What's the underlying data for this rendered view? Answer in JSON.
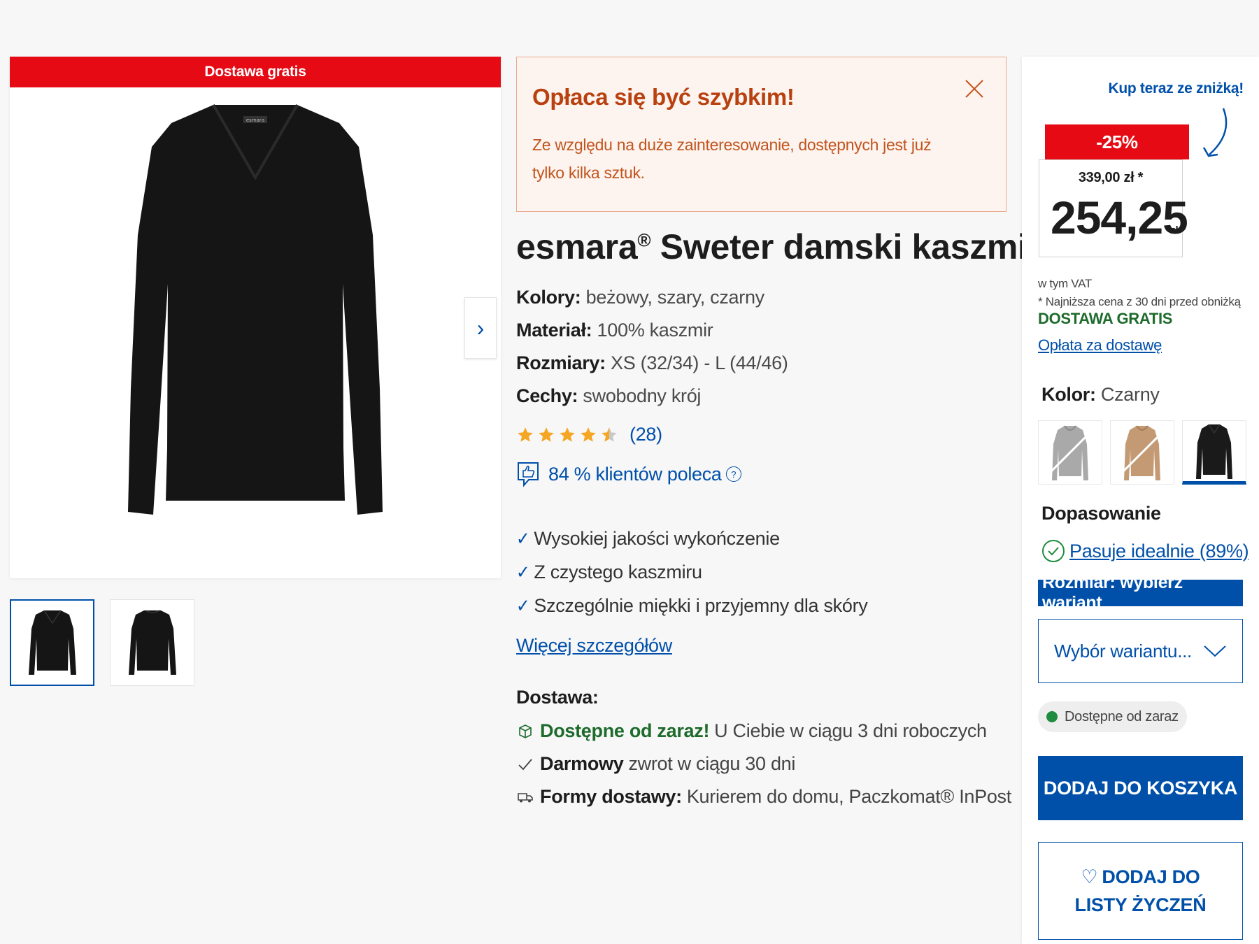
{
  "gallery": {
    "banner": "Dostawa gratis",
    "next_glyph": "›",
    "thumbnails": [
      "front",
      "back"
    ]
  },
  "alert": {
    "title": "Opłaca się być szybkim!",
    "text": "Ze względu na duże zainteresowanie, dostępnych jest już tylko kilka sztuk."
  },
  "product": {
    "brand": "esmara",
    "brand_mark": "®",
    "name": " Sweter damski kaszmirowy",
    "attributes": [
      {
        "label": "Kolory:",
        "value": " beżowy, szary, czarny"
      },
      {
        "label": "Materiał:",
        "value": " 100% kaszmir"
      },
      {
        "label": "Rozmiary:",
        "value": " XS (32/34) - L (44/46)"
      },
      {
        "label": "Cechy:",
        "value": " swobodny krój"
      }
    ],
    "rating": 4.5,
    "rating_count": "(28)",
    "recommend_text": "84 % klientów poleca",
    "features": [
      "Wysokiej jakości wykończenie",
      "Z czystego kaszmiru",
      "Szczególnie miękki i przyjemny dla skóry"
    ],
    "feature_check": "✓",
    "more_details": "Więcej szczegółów"
  },
  "delivery": {
    "heading": "Dostawa:",
    "items": [
      {
        "icon": "box-icon",
        "strong": "Dostępne od zaraz!",
        "text": " U Ciebie w ciągu 3 dni roboczych"
      },
      {
        "icon": "check-icon",
        "strong": "Darmowy",
        "text": " zwrot w ciągu 30 dni"
      },
      {
        "icon": "truck-icon",
        "strong": "Formy dostawy:",
        "text": " Kurierem do domu, Paczkomat® InPost"
      }
    ]
  },
  "pricing": {
    "promo_note": "Kup teraz ze zniżką!",
    "discount": "-25%",
    "old_price": "339,00 zł *",
    "new_price": "254,25",
    "currency": "zł",
    "vat": "w tym VAT",
    "lowest_note": "* Najniższa cena z 30 dni przed obniżką",
    "free_delivery": "DOSTAWA GRATIS",
    "delivery_fee_link": "Opłata za dostawę"
  },
  "color": {
    "label": "Kolor:",
    "selected": " Czarny",
    "swatches": [
      {
        "name": "szary",
        "hex": "#a9a9a9",
        "available": false
      },
      {
        "name": "beżowy",
        "hex": "#c49a74",
        "available": false
      },
      {
        "name": "czarny",
        "hex": "#1a1a1a",
        "available": true
      }
    ]
  },
  "fit": {
    "heading": "Dopasowanie",
    "link": "Pasuje idealnie (89%)"
  },
  "size": {
    "bar": "Rozmiar: wybierz wariant",
    "select_placeholder": "Wybór wariantu..."
  },
  "availability": "Dostępne od zaraz",
  "actions": {
    "add_to_cart": "DODAJ DO KOSZYKA",
    "add_to_wishlist": "DODAJ DO LISTY ŻYCZEŃ",
    "wishlist_glyph": "♡"
  },
  "colors": {
    "accent_blue": "#0050aa",
    "brand_red": "#e60a14",
    "green": "#1e6b2c",
    "alert_text": "#c2551d"
  }
}
